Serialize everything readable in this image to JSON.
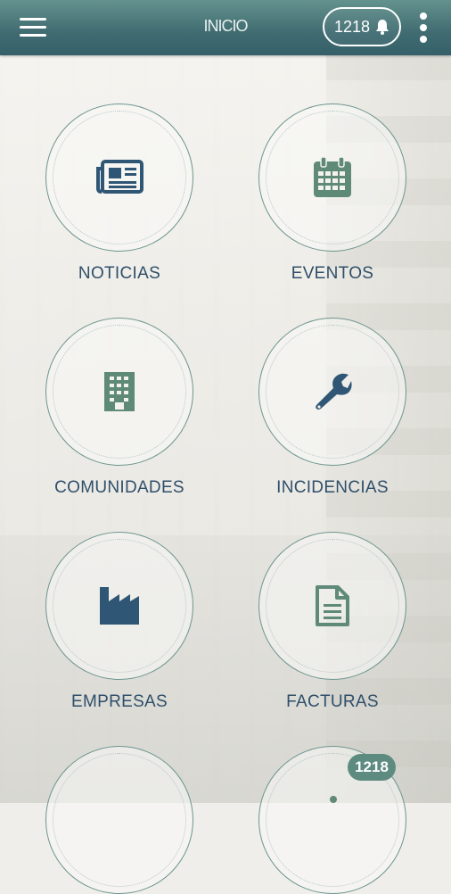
{
  "header": {
    "title": "INICIO",
    "notification_count": "1218",
    "icons": {
      "menu": "hamburger-menu-icon",
      "bell": "bell-icon",
      "more": "more-vertical-icon"
    }
  },
  "tiles": [
    {
      "label": "NOTICIAS",
      "icon": "newspaper-icon"
    },
    {
      "label": "EVENTOS",
      "icon": "calendar-icon"
    },
    {
      "label": "COMUNIDADES",
      "icon": "building-icon"
    },
    {
      "label": "INCIDENCIAS",
      "icon": "wrench-icon"
    },
    {
      "label": "EMPRESAS",
      "icon": "factory-icon"
    },
    {
      "label": "FACTURAS",
      "icon": "document-icon"
    }
  ],
  "bottom_badge": "1218",
  "colors": {
    "header_top": "#64928d",
    "header_bottom": "#35606a",
    "icon_green": "#5f8a78",
    "icon_blue": "#2f5674",
    "label": "#2f4f6a"
  }
}
